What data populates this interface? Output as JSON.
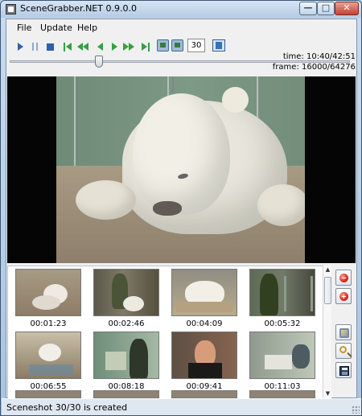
{
  "window": {
    "title": "SceneGrabber.NET 0.9.0.0",
    "controls": {
      "minimize": "—",
      "maximize": "□",
      "close": "✕"
    }
  },
  "menubar": {
    "items": [
      "File",
      "Update",
      "Help"
    ]
  },
  "toolbar": {
    "frame_step": "30",
    "icons": [
      "play-icon",
      "pause-icon",
      "stop-icon",
      "skip-start-icon",
      "fast-rewind-icon",
      "step-back-icon",
      "step-forward-icon",
      "fast-forward-icon",
      "skip-end-icon",
      "capture-frame-icon",
      "capture-series-icon",
      "settings-book-icon"
    ]
  },
  "playback": {
    "time_label": "time: 10:40/42:51",
    "frame_label": "frame: 16000/64276",
    "position_fraction": 0.248
  },
  "video": {
    "content": "polar-bear-cub"
  },
  "thumbnails": [
    {
      "time": "00:01:23"
    },
    {
      "time": "00:02:46"
    },
    {
      "time": "00:04:09"
    },
    {
      "time": "00:05:32"
    },
    {
      "time": "00:06:55"
    },
    {
      "time": "00:08:18"
    },
    {
      "time": "00:09:41"
    },
    {
      "time": "00:11:03"
    }
  ],
  "side_tools": [
    {
      "icon": "remove-icon"
    },
    {
      "icon": "delete-all-icon"
    },
    {
      "icon": "edit-image-icon"
    },
    {
      "icon": "zoom-icon"
    },
    {
      "icon": "save-icon"
    }
  ],
  "status": {
    "text": "Sceneshot 30/30 is created"
  },
  "colors": {
    "accent": "#2f61ad",
    "green": "#32a13f",
    "close": "#c64131"
  }
}
